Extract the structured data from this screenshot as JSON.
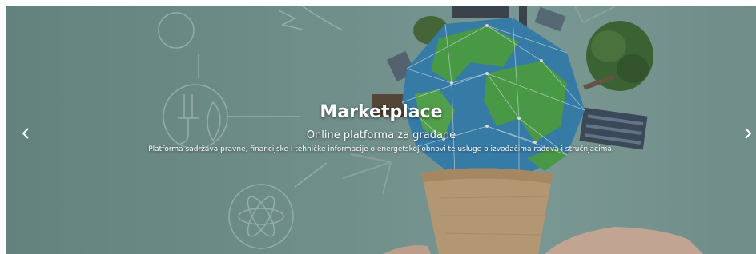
{
  "slide": {
    "title": "Marketplace",
    "subtitle": "Online platforma za građane",
    "description": "Platforma sadržava pravne, financijske i tehničke informacije o energetskoj obnovi te usluge o izvođačima radova i stručnjacima."
  },
  "controls": {
    "prev_icon": "chevron-left-icon",
    "next_icon": "chevron-right-icon"
  },
  "colors": {
    "background": "#7a9c97",
    "text": "#ffffff",
    "globe_ocean": "#3a86b8",
    "globe_land": "#4fa84a",
    "cup": "#c8a57d"
  }
}
